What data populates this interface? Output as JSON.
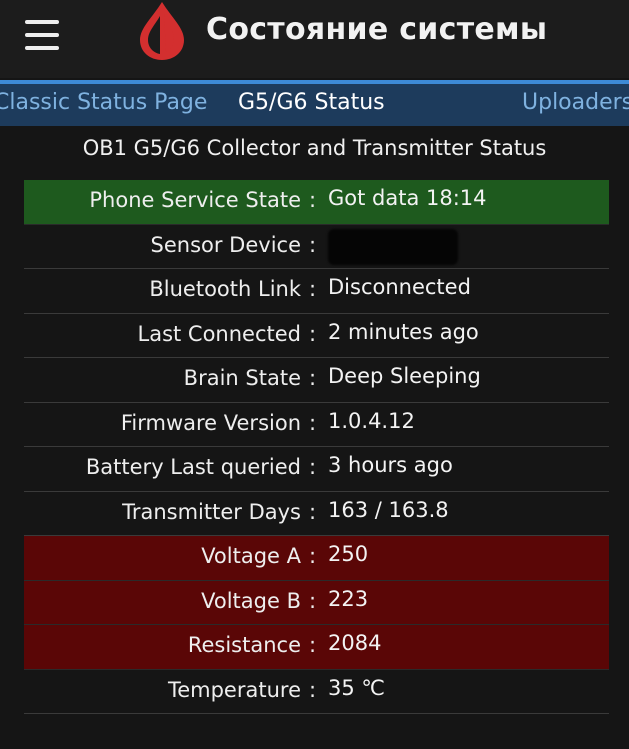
{
  "header": {
    "title": "Состояние системы",
    "menu_icon": "hamburger-menu-icon",
    "logo_icon": "blood-drop-logo-icon",
    "logo_color": "#d32f2f"
  },
  "tabs": [
    {
      "label": "Classic Status Page",
      "active": false
    },
    {
      "label": "G5/G6 Status",
      "active": true
    },
    {
      "label": "Uploaders",
      "active": false
    }
  ],
  "subtitle": "OB1 G5/G6 Collector and Transmitter Status",
  "colors": {
    "ok_row": "#1e5a1e",
    "warning_row": "#5a0606",
    "tab_accent": "#3d8ad6"
  },
  "rows": [
    {
      "label": "Phone Service State",
      "value": "Got data 18:14",
      "status": "ok"
    },
    {
      "label": "Sensor Device",
      "value": "",
      "status": "normal",
      "redacted": true
    },
    {
      "label": "Bluetooth Link",
      "value": "Disconnected",
      "status": "normal"
    },
    {
      "label": "Last Connected",
      "value": "2 minutes ago",
      "status": "normal"
    },
    {
      "label": "Brain State",
      "value": "Deep Sleeping",
      "status": "normal"
    },
    {
      "label": "Firmware Version",
      "value": "1.0.4.12",
      "status": "normal"
    },
    {
      "label": "Battery Last queried",
      "value": "3 hours ago",
      "status": "normal"
    },
    {
      "label": "Transmitter Days",
      "value": "163 / 163.8",
      "status": "normal"
    },
    {
      "label": "Voltage A",
      "value": "250",
      "status": "warning"
    },
    {
      "label": "Voltage B",
      "value": "223",
      "status": "warning"
    },
    {
      "label": "Resistance",
      "value": "2084",
      "status": "warning"
    },
    {
      "label": "Temperature",
      "value": "35 ℃",
      "status": "normal"
    }
  ],
  "separator": ":"
}
